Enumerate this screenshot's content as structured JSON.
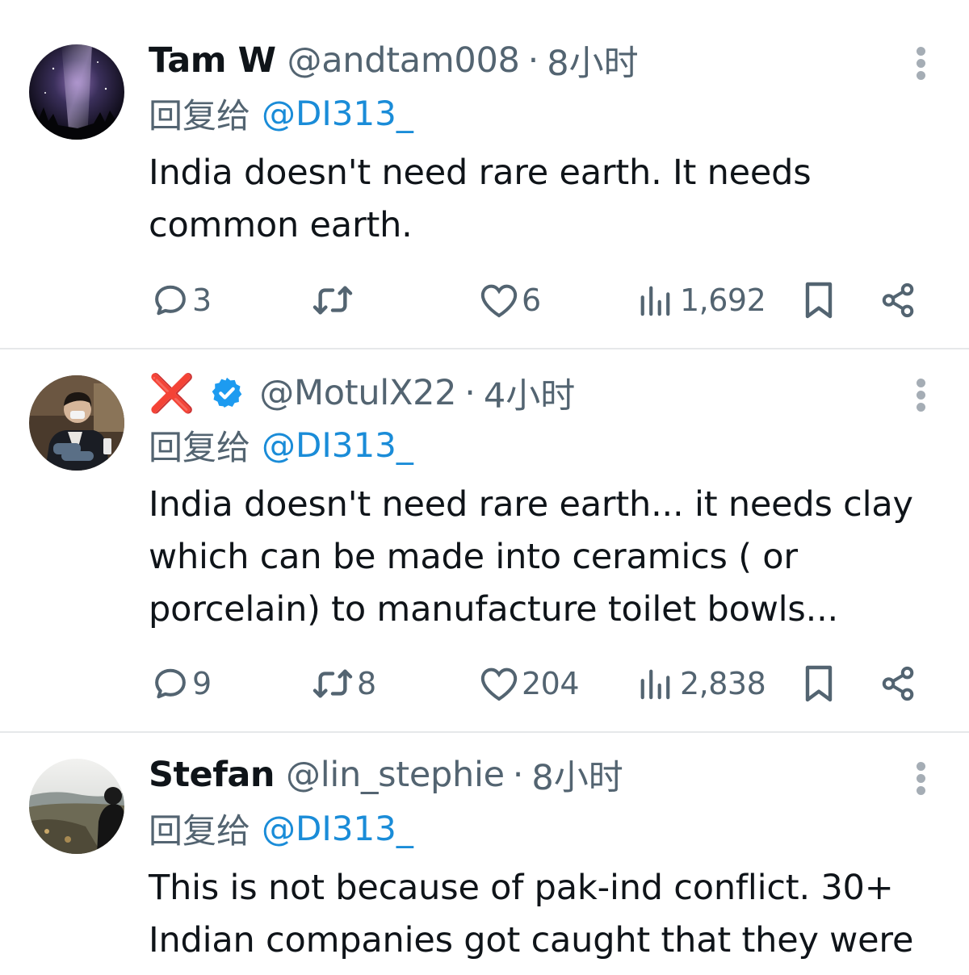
{
  "tweets": [
    {
      "name": "Tam W",
      "handle": "@andtam008",
      "separator": "·",
      "time": "8小时",
      "reply_prefix": "回复给",
      "reply_target": "@DI313_",
      "body_lines": [
        "India doesn't need rare earth. It needs",
        "common earth."
      ],
      "replies": "3",
      "retweets": "",
      "likes": "6",
      "views": "1,692"
    },
    {
      "name": "",
      "name_badge": "❌",
      "verified": true,
      "handle": "@MotulX22",
      "separator": "·",
      "time": "4小时",
      "reply_prefix": "回复给",
      "reply_target": "@DI313_",
      "body_lines": [
        "India doesn't need rare earth... it needs clay",
        "which can be made into ceramics ( or",
        "porcelain) to manufacture toilet bowls..."
      ],
      "replies": "9",
      "retweets": "8",
      "likes": "204",
      "views": "2,838"
    },
    {
      "name": "Stefan",
      "handle": "@lin_stephie",
      "separator": "·",
      "time": "8小时",
      "reply_prefix": "回复给",
      "reply_target": "@DI313_",
      "body_lines": [
        "This is not because of pak-ind conflict. 30+",
        "Indian companies got caught that they were"
      ]
    }
  ],
  "icons": {
    "reply": "speech-bubble-icon",
    "retweet": "retweet-arrows-icon",
    "like": "heart-outline-icon",
    "views": "bar-chart-icon",
    "bookmark": "bookmark-icon",
    "share": "share-nodes-icon",
    "more": "vertical-dots-icon",
    "verified": "verified-check-icon"
  },
  "colors": {
    "text": "#0f1419",
    "secondary": "#536471",
    "link": "#1a8cd8",
    "verified": "#1d9bf0",
    "badge_x": "#e0245e",
    "divider": "#e6e8ea"
  }
}
